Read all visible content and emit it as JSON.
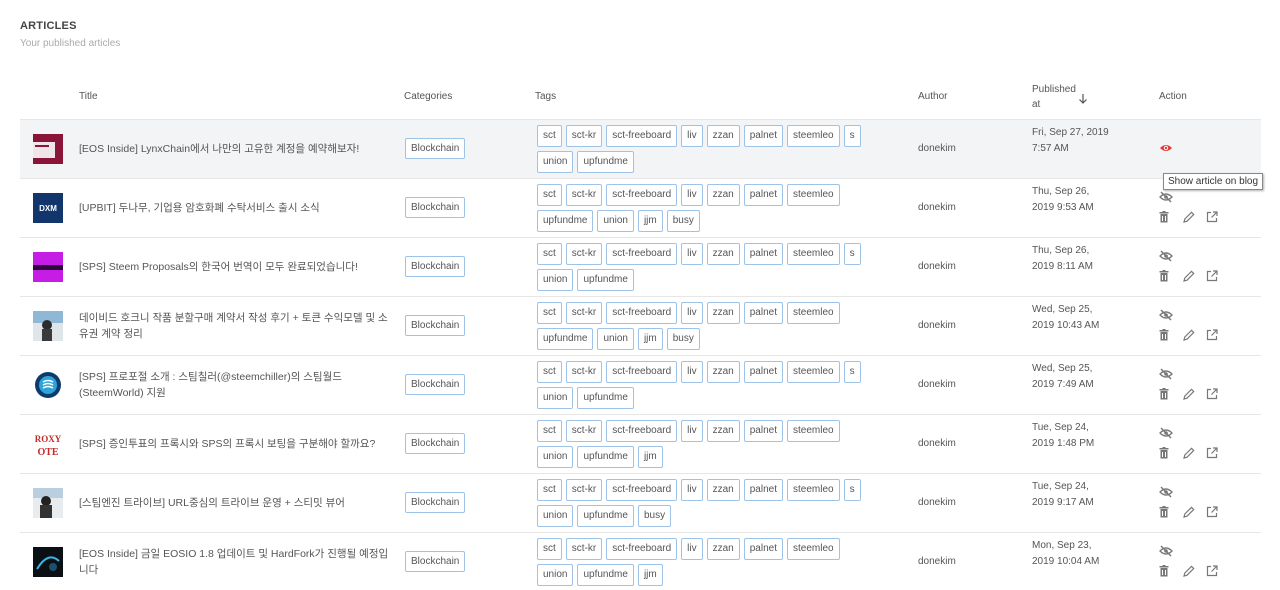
{
  "header": {
    "title": "ARTICLES",
    "subtitle": "Your published articles"
  },
  "columns": {
    "title": "Title",
    "categories": "Categories",
    "tags": "Tags",
    "author": "Author",
    "published": "Published at",
    "action": "Action"
  },
  "tooltip": "Show article on blog",
  "colors": {
    "accent_eye": "#e53935",
    "tag_border": "#9ec3e8",
    "hover_row": "#f3f4f6"
  },
  "rows": [
    {
      "title": "[EOS Inside] LynxChain에서 나만의 고유한 계정을 예약해보자!",
      "category": "Blockchain",
      "tags": [
        "sct",
        "sct-kr",
        "sct-freeboard",
        "liv",
        "zzan",
        "palnet",
        "steemleo",
        "s",
        "union",
        "upfundme"
      ],
      "author": "donekim",
      "date": "Fri, Sep 27, 2019 7:57 AM",
      "visible": true
    },
    {
      "title": "[UPBIT] 두나무, 기업용 암호화폐 수탁서비스 출시 소식",
      "category": "Blockchain",
      "tags": [
        "sct",
        "sct-kr",
        "sct-freeboard",
        "liv",
        "zzan",
        "palnet",
        "steemleo",
        "upfundme",
        "union",
        "jjm",
        "busy"
      ],
      "author": "donekim",
      "date": "Thu, Sep 26, 2019 9:53 AM",
      "visible": false
    },
    {
      "title": "[SPS] Steem Proposals의 한국어 번역이 모두 완료되었습니다!",
      "category": "Blockchain",
      "tags": [
        "sct",
        "sct-kr",
        "sct-freeboard",
        "liv",
        "zzan",
        "palnet",
        "steemleo",
        "s",
        "union",
        "upfundme"
      ],
      "author": "donekim",
      "date": "Thu, Sep 26, 2019 8:11 AM",
      "visible": false
    },
    {
      "title": "데이비드 호크니 작품 분할구매 계약서 작성 후기 + 토큰 수익모델 및 소유권 계약 정리",
      "category": "Blockchain",
      "tags": [
        "sct",
        "sct-kr",
        "sct-freeboard",
        "liv",
        "zzan",
        "palnet",
        "steemleo",
        "upfundme",
        "union",
        "jjm",
        "busy"
      ],
      "author": "donekim",
      "date": "Wed, Sep 25, 2019 10:43 AM",
      "visible": false
    },
    {
      "title": "[SPS] 프로포절 소개 : 스팀칠러(@steemchiller)의 스팀월드(SteemWorld) 지원",
      "category": "Blockchain",
      "tags": [
        "sct",
        "sct-kr",
        "sct-freeboard",
        "liv",
        "zzan",
        "palnet",
        "steemleo",
        "s",
        "union",
        "upfundme"
      ],
      "author": "donekim",
      "date": "Wed, Sep 25, 2019 7:49 AM",
      "visible": false
    },
    {
      "title": "[SPS] 증인투표의 프록시와 SPS의 프록시 보팅을 구분해야 할까요?",
      "category": "Blockchain",
      "tags": [
        "sct",
        "sct-kr",
        "sct-freeboard",
        "liv",
        "zzan",
        "palnet",
        "steemleo",
        "union",
        "upfundme",
        "jjm"
      ],
      "author": "donekim",
      "date": "Tue, Sep 24, 2019 1:48 PM",
      "visible": false
    },
    {
      "title": "[스팀엔진 트라이브] URL중심의 트라이브 운영 + 스티밋 뷰어",
      "category": "Blockchain",
      "tags": [
        "sct",
        "sct-kr",
        "sct-freeboard",
        "liv",
        "zzan",
        "palnet",
        "steemleo",
        "s",
        "union",
        "upfundme",
        "busy"
      ],
      "author": "donekim",
      "date": "Tue, Sep 24, 2019 9:17 AM",
      "visible": false
    },
    {
      "title": "[EOS Inside] 금일 EOSIO 1.8 업데이트 및 HardFork가 진행될 예정입니다",
      "category": "Blockchain",
      "tags": [
        "sct",
        "sct-kr",
        "sct-freeboard",
        "liv",
        "zzan",
        "palnet",
        "steemleo",
        "union",
        "upfundme",
        "jjm"
      ],
      "author": "donekim",
      "date": "Mon, Sep 23, 2019 10:04 AM",
      "visible": false
    }
  ]
}
